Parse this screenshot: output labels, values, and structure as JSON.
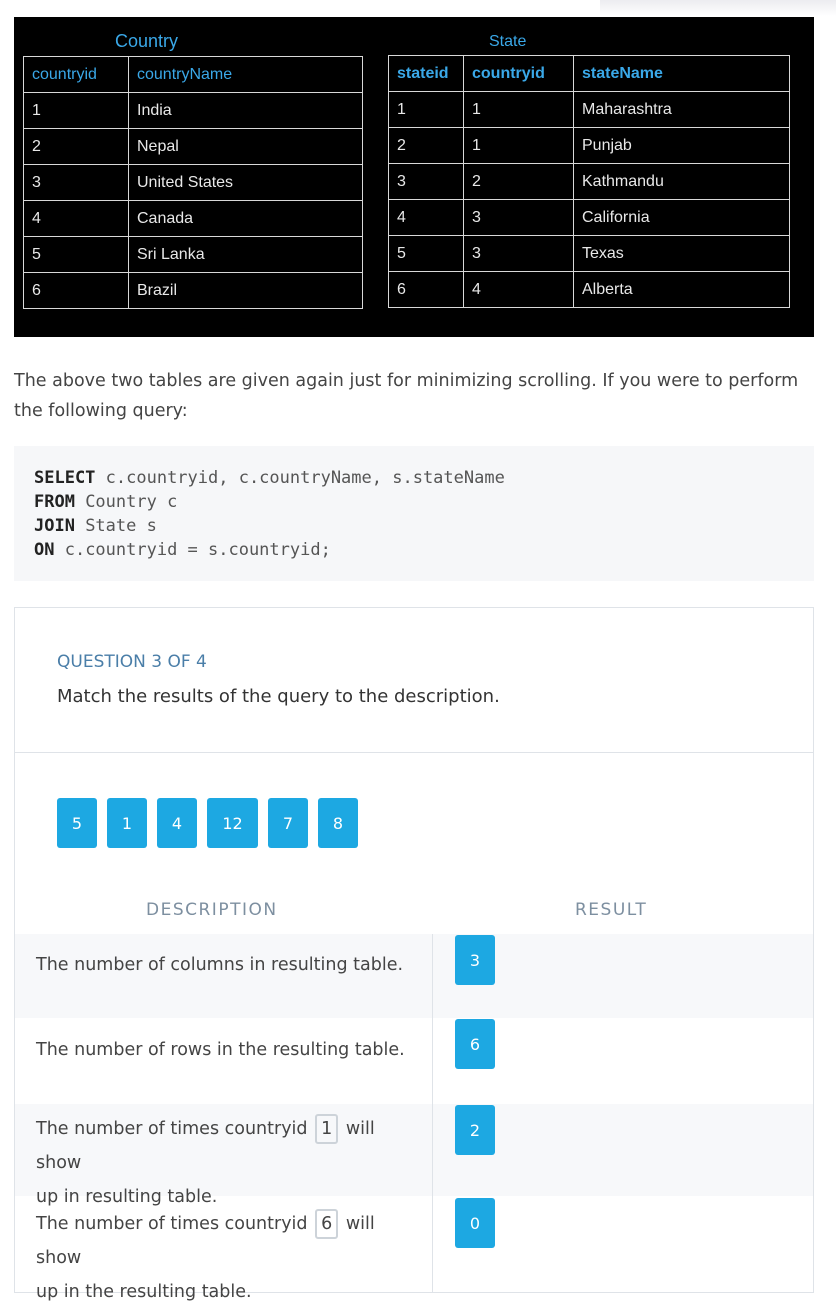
{
  "tables": {
    "country": {
      "title": "Country",
      "headers": [
        "countryid",
        "countryName"
      ],
      "rows": [
        [
          "1",
          "India"
        ],
        [
          "2",
          "Nepal"
        ],
        [
          "3",
          "United States"
        ],
        [
          "4",
          "Canada"
        ],
        [
          "5",
          "Sri Lanka"
        ],
        [
          "6",
          "Brazil"
        ]
      ]
    },
    "state": {
      "title": "State",
      "headers": [
        "stateid",
        "countryid",
        "stateName"
      ],
      "rows": [
        [
          "1",
          "1",
          "Maharashtra"
        ],
        [
          "2",
          "1",
          "Punjab"
        ],
        [
          "3",
          "2",
          "Kathmandu"
        ],
        [
          "4",
          "3",
          "California"
        ],
        [
          "5",
          "3",
          "Texas"
        ],
        [
          "6",
          "4",
          "Alberta"
        ]
      ]
    }
  },
  "intro": "The above two tables are given again just for minimizing scrolling. If you were to perform the following query:",
  "query": {
    "line1_kw": "SELECT",
    "line1_rest": " c.countryid, c.countryName, s.stateName",
    "line2_kw": "FROM",
    "line2_rest": " Country c",
    "line3_kw": "JOIN",
    "line3_rest": " State s",
    "line4_kw": "ON",
    "line4_rest": " c.countryid = s.countryid;"
  },
  "question": {
    "label": "QUESTION 3 OF 4",
    "text": "Match the results of the query to the description.",
    "options": [
      "5",
      "1",
      "4",
      "12",
      "7",
      "8"
    ],
    "description_header": "DESCRIPTION",
    "result_header": "RESULT",
    "items": [
      {
        "desc_a": "The number of columns in resulting table.",
        "answer": "3"
      },
      {
        "desc_a": "The number of rows in the resulting table.",
        "answer": "6"
      },
      {
        "desc_pre": "The number of times countryid",
        "desc_num": "1",
        "desc_post": "will show",
        "desc_line2": "up in resulting table.",
        "answer": "2"
      },
      {
        "desc_pre": "The number of times countryid",
        "desc_num": "6",
        "desc_post": "will show",
        "desc_line2": "up in the resulting table.",
        "answer": "0"
      }
    ]
  },
  "colors": {
    "accent": "#1da8e2",
    "table_header": "#3aa8e8"
  }
}
